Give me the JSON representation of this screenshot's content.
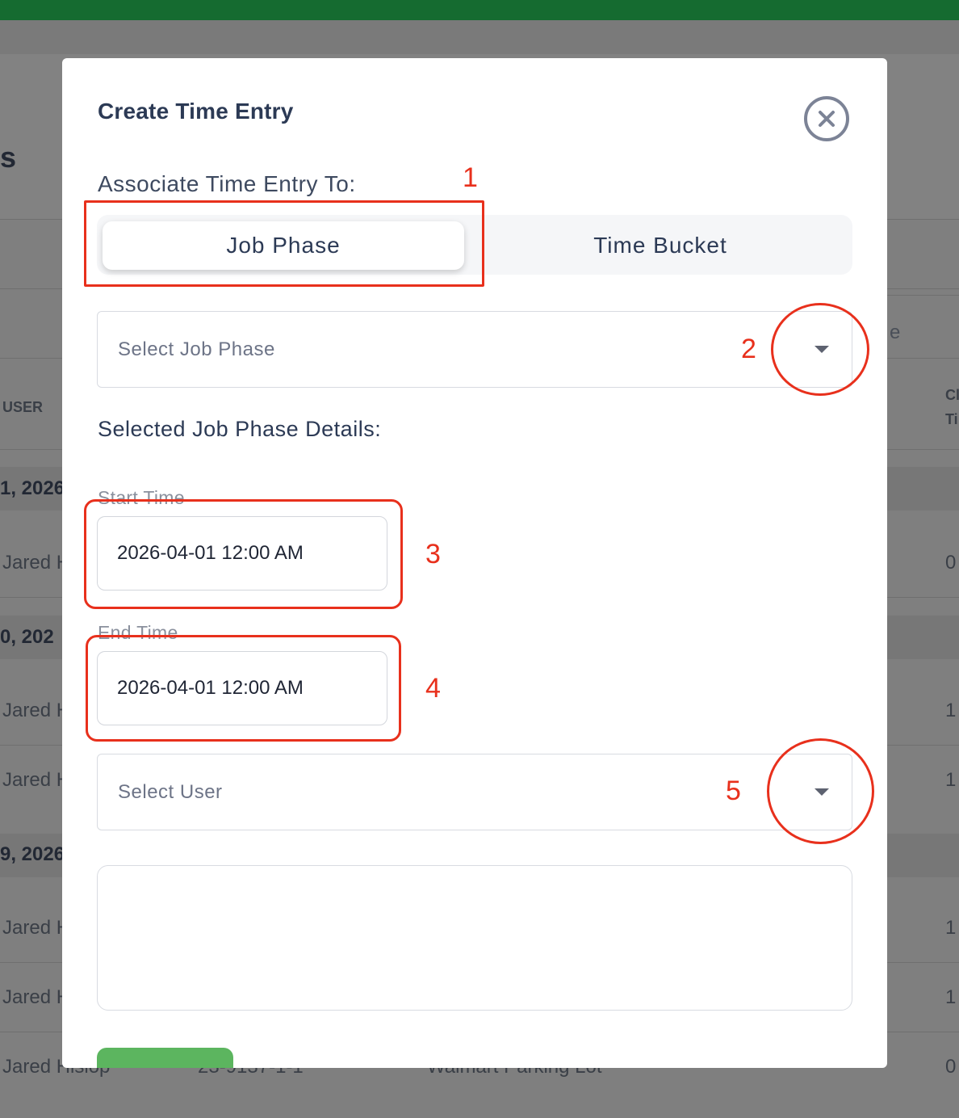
{
  "background": {
    "heading_fragment": "s",
    "column_user": "USER",
    "column_right_top": "Cl",
    "column_right_bottom": "Ti",
    "partial_right_label": "e",
    "date_groups": [
      "1, 2026",
      "0, 202",
      "9, 2026"
    ],
    "rows": [
      "Jared H",
      "Jared H",
      "Jared H",
      "Jared H",
      "Jared H",
      "Jared Hislop"
    ],
    "row_right_values": [
      "0",
      "1",
      "1",
      "1",
      "1",
      "0"
    ],
    "bottom_row_mid": "23-9137-1-1",
    "bottom_row_location": "Walmart Parking Lot"
  },
  "modal": {
    "title": "Create Time Entry",
    "associate_label": "Associate Time Entry To:",
    "toggle": {
      "options": [
        "Job Phase",
        "Time Bucket"
      ],
      "selected": "Job Phase"
    },
    "job_phase_select": {
      "placeholder": "Select Job Phase",
      "value": ""
    },
    "details_label": "Selected Job Phase Details:",
    "start_time": {
      "label": "Start Time",
      "value": "2026-04-01 12:00 AM"
    },
    "end_time": {
      "label": "End Time",
      "value": "2026-04-01 12:00 AM"
    },
    "user_select": {
      "placeholder": "Select User",
      "value": ""
    },
    "notes": {
      "value": ""
    }
  },
  "annotations": {
    "labels": [
      "1",
      "2",
      "3",
      "4",
      "5"
    ],
    "color": "#e8301c"
  },
  "colors": {
    "topbar": "#156b30",
    "submit_button": "#5cb55f",
    "overlay": "#7f7f7f"
  }
}
